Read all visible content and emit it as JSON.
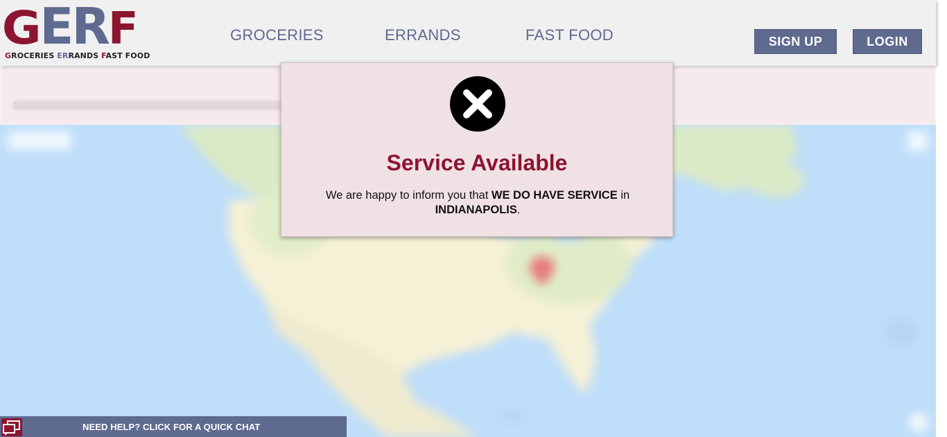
{
  "logo": {
    "letters": [
      "G",
      "E",
      "R",
      "F"
    ],
    "tagline": {
      "g": "G",
      "roceries": "ROCERIES ",
      "er": "ER",
      "rands": "RANDS ",
      "f": "F",
      "astfood": "AST FOOD"
    }
  },
  "nav": {
    "groceries": "GROCERIES",
    "errands": "ERRANDS",
    "fastfood": "FAST FOOD"
  },
  "auth": {
    "signup": "SIGN UP",
    "login": "LOGIN"
  },
  "modal": {
    "title": "Service Available",
    "text_before": "We are happy to inform you that ",
    "text_bold": "WE DO HAVE SERVICE",
    "text_mid": " in ",
    "city": "INDIANAPOLIS",
    "text_end": "."
  },
  "chat": {
    "label": "NEED HELP? CLICK FOR A QUICK CHAT"
  },
  "colors": {
    "brand_red": "#8c1530",
    "brand_blue": "#5e6a8e",
    "modal_bg": "#f0e1e5",
    "map_water": "#aad3f7"
  },
  "icons": {
    "modal_icon": "close-circle-icon",
    "chat_icon": "chat-bubbles-icon",
    "map_marker": "map-marker-icon"
  }
}
